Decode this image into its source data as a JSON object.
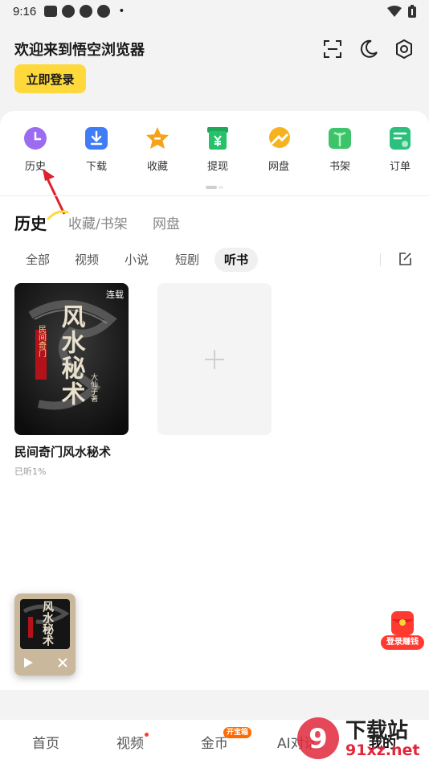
{
  "status_bar": {
    "time": "9:16",
    "separator": "•"
  },
  "header": {
    "welcome_text": "欢迎来到悟空浏览器",
    "login_label": "立即登录"
  },
  "quick_actions": [
    {
      "label": "历史",
      "icon": "history-icon",
      "color": "#9c6cf0"
    },
    {
      "label": "下载",
      "icon": "download-icon",
      "color": "#3f7cf5"
    },
    {
      "label": "收藏",
      "icon": "star-icon",
      "color": "#f7a21b"
    },
    {
      "label": "提现",
      "icon": "withdraw-icon",
      "color": "#25c26a"
    },
    {
      "label": "网盘",
      "icon": "cloud-drive-icon",
      "color": "#f5b320"
    },
    {
      "label": "书架",
      "icon": "bookshelf-icon",
      "color": "#3dc46a"
    },
    {
      "label": "订单",
      "icon": "order-icon",
      "color": "#2cc07c"
    }
  ],
  "tabs": [
    {
      "label": "历史",
      "active": true
    },
    {
      "label": "收藏/书架",
      "active": false
    },
    {
      "label": "网盘",
      "active": false
    }
  ],
  "filters": [
    {
      "label": "全部",
      "active": false
    },
    {
      "label": "视频",
      "active": false
    },
    {
      "label": "小说",
      "active": false
    },
    {
      "label": "短剧",
      "active": false
    },
    {
      "label": "听书",
      "active": true
    }
  ],
  "history_item": {
    "badge": "连载",
    "title": "民间奇门风水秘术",
    "progress": "已听1%",
    "cover_text": "风水秘术",
    "cover_subtitle": "民间奇门",
    "cover_author": "大仙子著"
  },
  "promo": {
    "label": "登录赚钱"
  },
  "bottom_nav": [
    {
      "label": "首页",
      "active": false
    },
    {
      "label": "视频",
      "active": false
    },
    {
      "label": "金币",
      "active": false
    },
    {
      "label": "AI对话",
      "active": false
    },
    {
      "label": "我的",
      "active": true
    }
  ],
  "coins_badge": "开宝箱",
  "watermark": {
    "title": "下载站",
    "url": "91xz.net",
    "logo_text": "9"
  },
  "colors": {
    "accent_yellow": "#ffd93b",
    "promo_red": "#ff3b30",
    "arrow_red": "#e0202b"
  }
}
